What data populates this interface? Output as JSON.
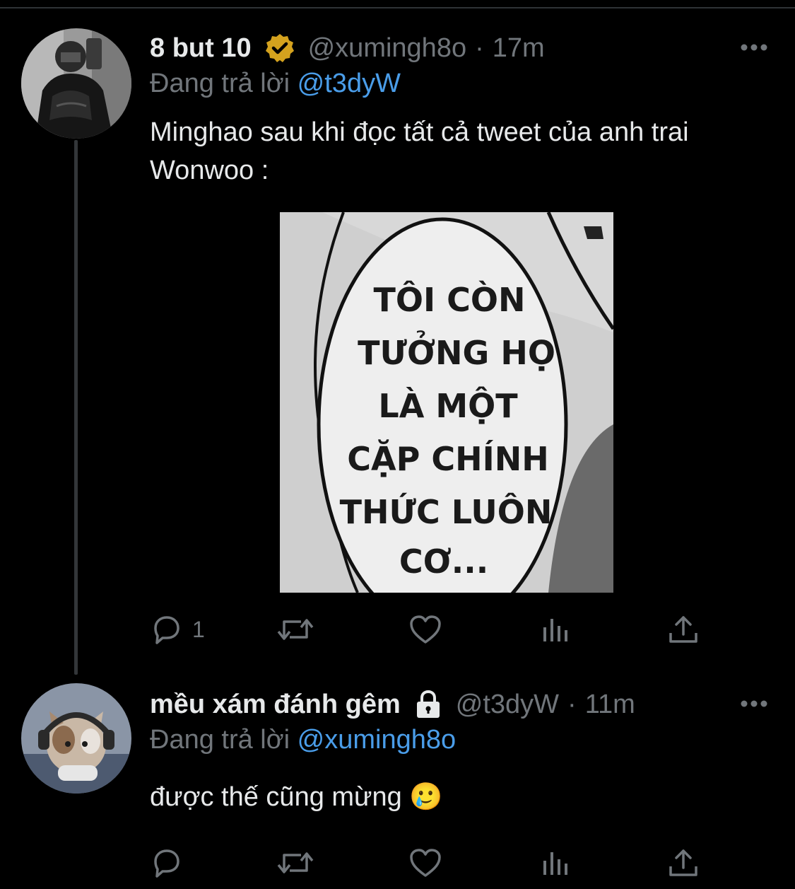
{
  "tweets": [
    {
      "display_name": "8 but 10",
      "verified_icon": "verified-gold-badge-icon",
      "handle": "@xumingh8o",
      "separator": "·",
      "time": "17m",
      "reply_prefix": "Đang trả lời",
      "reply_target": "@t3dyW",
      "text": "Minghao sau khi đọc tất cả tweet của anh trai Wonwoo :",
      "media": {
        "lines": [
          "TÔI CÒN",
          "TƯỞNG HỌ",
          "LÀ MỘT",
          "CẶP CHÍNH",
          "THỨC LUÔN",
          "CƠ..."
        ]
      },
      "actions": {
        "reply_count": "1",
        "retweet_count": "",
        "like_count": ""
      }
    },
    {
      "display_name": "mều xám đánh gêm",
      "lock_icon": "lock-icon",
      "handle": "@t3dyW",
      "separator": "·",
      "time": "11m",
      "reply_prefix": "Đang trả lời",
      "reply_target": "@xumingh8o",
      "text": "được thế cũng mừng",
      "emoji": "🥲",
      "actions": {
        "reply_count": "",
        "retweet_count": "",
        "like_count": ""
      }
    }
  ],
  "colors": {
    "background": "#000000",
    "text": "#e7e9ea",
    "secondary": "#71767b",
    "link": "#4a9de9",
    "badge": "#d4a21e"
  }
}
